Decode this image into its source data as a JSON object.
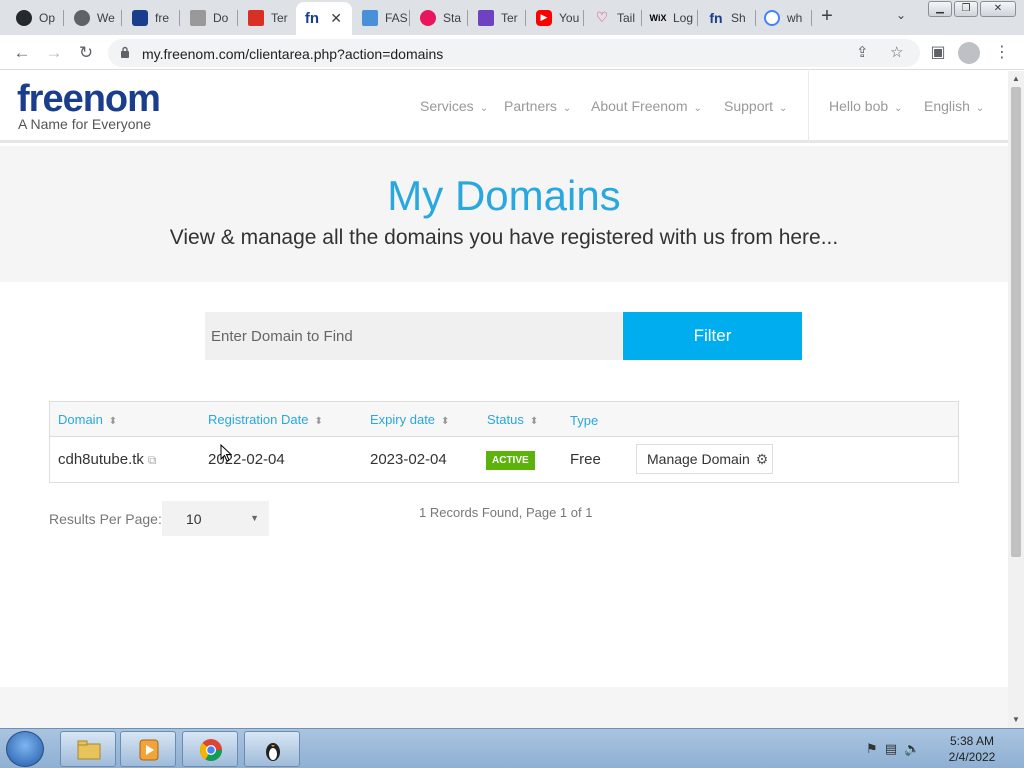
{
  "browser": {
    "tabs": [
      {
        "label": "Op",
        "icon": "github-icon",
        "color": "#24292e"
      },
      {
        "label": "We",
        "icon": "globe-icon",
        "color": "#5f6368"
      },
      {
        "label": "fre",
        "icon": "shield-icon",
        "color": "#1a3e8c"
      },
      {
        "label": "Do",
        "icon": "document-icon",
        "color": "#777777"
      },
      {
        "label": "Ter",
        "icon": "gmail-icon",
        "color": "#d93025"
      },
      {
        "label": "",
        "icon": "freenom-icon",
        "color": "#1a3e8c",
        "active": true
      },
      {
        "label": "FAS",
        "icon": "click-icon",
        "color": "#4a90d9"
      },
      {
        "label": "Sta",
        "icon": "record-icon",
        "color": "#e8175d"
      },
      {
        "label": "Ter",
        "icon": "tools-icon",
        "color": "#6f42c1"
      },
      {
        "label": "You",
        "icon": "youtube-icon",
        "color": "#ff0000"
      },
      {
        "label": "Tail",
        "icon": "heart-icon",
        "color": "#e0245e"
      },
      {
        "label": "Log",
        "icon": "wix-icon",
        "color": "#000000"
      },
      {
        "label": "Sh",
        "icon": "freenom-icon",
        "color": "#1a3e8c"
      },
      {
        "label": "wh",
        "icon": "google-icon",
        "color": "#4285f4"
      }
    ],
    "url": "my.freenom.com/clientarea.php?action=domains"
  },
  "site": {
    "logo_text": "freenom",
    "tagline": "A Name for Everyone",
    "nav": {
      "services": "Services",
      "partners": "Partners",
      "about": "About Freenom",
      "support": "Support",
      "user": "Hello bob",
      "language": "English"
    },
    "brand_color": "#29a7df"
  },
  "hero": {
    "title": "My Domains",
    "subtitle": "View & manage all the domains you have registered with us from here..."
  },
  "filter": {
    "placeholder": "Enter Domain to Find",
    "button": "Filter"
  },
  "table": {
    "headers": {
      "domain": "Domain",
      "registration": "Registration Date",
      "expiry": "Expiry date",
      "status": "Status",
      "type": "Type"
    },
    "rows": [
      {
        "domain": "cdh8utube.tk",
        "registration": "2022-02-04",
        "expiry": "2023-02-04",
        "status": "ACTIVE",
        "type": "Free",
        "action": "Manage Domain"
      }
    ]
  },
  "pagination": {
    "results_label": "Results Per Page:",
    "per_page": "10",
    "records": "1 Records Found, Page 1 of 1"
  },
  "taskbar": {
    "time": "5:38 AM",
    "date": "2/4/2022"
  }
}
